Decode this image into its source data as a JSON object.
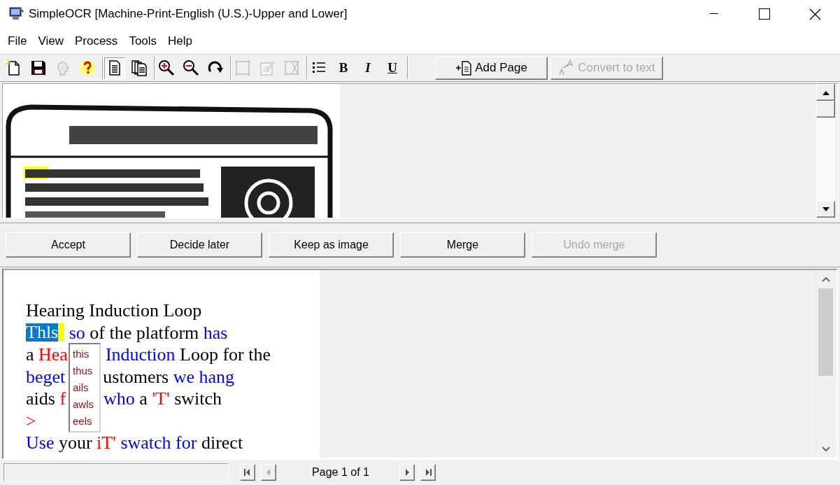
{
  "window": {
    "title": "SimpleOCR [Machine-Print-English (U.S.)-Upper and Lower]"
  },
  "menu": [
    {
      "label": "File"
    },
    {
      "label": "View"
    },
    {
      "label": "Process"
    },
    {
      "label": "Tools"
    },
    {
      "label": "Help"
    }
  ],
  "toolbar": {
    "groups": [
      {
        "buttons": [
          {
            "disabled": false,
            "selected": false
          },
          {
            "disabled": false,
            "selected": false
          },
          {
            "disabled": true,
            "selected": false
          },
          {
            "disabled": false,
            "selected": false
          }
        ]
      },
      {
        "buttons": [
          {
            "disabled": false,
            "selected": true
          },
          {
            "disabled": false,
            "selected": false
          }
        ]
      },
      {
        "buttons": [
          {
            "disabled": false,
            "selected": false
          },
          {
            "disabled": false,
            "selected": false
          },
          {
            "disabled": false,
            "selected": false
          }
        ]
      },
      {
        "buttons": [
          {
            "disabled": true,
            "selected": false
          },
          {
            "disabled": true,
            "selected": false
          },
          {
            "disabled": true,
            "selected": false
          }
        ]
      },
      {
        "buttons": [
          {
            "disabled": false,
            "selected": false
          },
          {
            "label": "B",
            "disabled": false,
            "selected": false
          },
          {
            "label": "I",
            "disabled": false,
            "selected": false
          },
          {
            "label": "U",
            "disabled": false,
            "selected": false
          }
        ]
      }
    ],
    "actions": [
      {
        "label": "Add Page",
        "disabled": false
      },
      {
        "label": "Convert to text",
        "disabled": true
      }
    ]
  },
  "decision_buttons": [
    {
      "label": "Accept",
      "disabled": false
    },
    {
      "label": "Decide later",
      "disabled": false
    },
    {
      "label": "Keep as image",
      "disabled": false
    },
    {
      "label": "Merge",
      "disabled": false
    },
    {
      "label": "Undo merge",
      "disabled": true
    }
  ],
  "editor": {
    "lines": [
      [
        {
          "text": "Hearing Induction Loop",
          "color": "#000000",
          "selected": false
        }
      ],
      [
        {
          "text": "Thls",
          "selected": true
        },
        {
          "text": "so",
          "color": "#0000ff",
          "selected": false
        },
        {
          "text": "of the platform",
          "color": "#000000",
          "selected": false
        },
        {
          "text": "has",
          "color": "#0000ff",
          "selected": false
        }
      ],
      [
        {
          "text": "a",
          "color": "#000000",
          "selected": false
        },
        {
          "text": "Hea",
          "color": "#ff0000",
          "selected": false
        },
        {
          "kind": "covered"
        },
        {
          "text": "Induction",
          "color": "#0000ff",
          "selected": false
        },
        {
          "text": "Loop for the",
          "color": "#000000",
          "selected": false
        }
      ],
      [
        {
          "text": "beget",
          "color": "#0000ff",
          "selected": false
        },
        {
          "kind": "covered"
        },
        {
          "text": "ustomers",
          "color": "#000000",
          "selected": false
        },
        {
          "text": "we hang",
          "color": "#0000ff",
          "selected": false
        }
      ],
      [
        {
          "text": "aids",
          "color": "#000000",
          "selected": false
        },
        {
          "text": "f",
          "color": "#ff0000",
          "selected": false
        },
        {
          "kind": "covered"
        },
        {
          "text": "who",
          "color": "#0000ff",
          "selected": false
        },
        {
          "text": "a",
          "color": "#000000",
          "selected": false
        },
        {
          "text": "'T'",
          "color": "#ff0000",
          "selected": false
        },
        {
          "text": "switch",
          "color": "#000000",
          "selected": false
        }
      ],
      [
        {
          "text": ">",
          "color": "#ff0000",
          "selected": false
        }
      ],
      [
        {
          "text": "Use",
          "color": "#0000ff",
          "selected": false
        },
        {
          "text": "your",
          "color": "#000000",
          "selected": false
        },
        {
          "text": "iT'",
          "color": "#ff0000",
          "selected": false
        },
        {
          "text": "swatch for",
          "color": "#0000ff",
          "selected": false
        },
        {
          "text": "direct",
          "color": "#000000",
          "selected": false
        }
      ]
    ],
    "suggestions": [
      {
        "text": "this"
      },
      {
        "text": "thus"
      },
      {
        "text": "ails"
      },
      {
        "text": "awls"
      },
      {
        "text": "eels"
      }
    ]
  },
  "status_bar": {
    "nav": [
      {
        "kind": "first",
        "disabled": false
      },
      {
        "kind": "prev",
        "disabled": true
      },
      {
        "kind": "page",
        "text": "Page 1 of 1"
      },
      {
        "kind": "next",
        "disabled": false
      },
      {
        "kind": "last",
        "disabled": false
      }
    ]
  }
}
